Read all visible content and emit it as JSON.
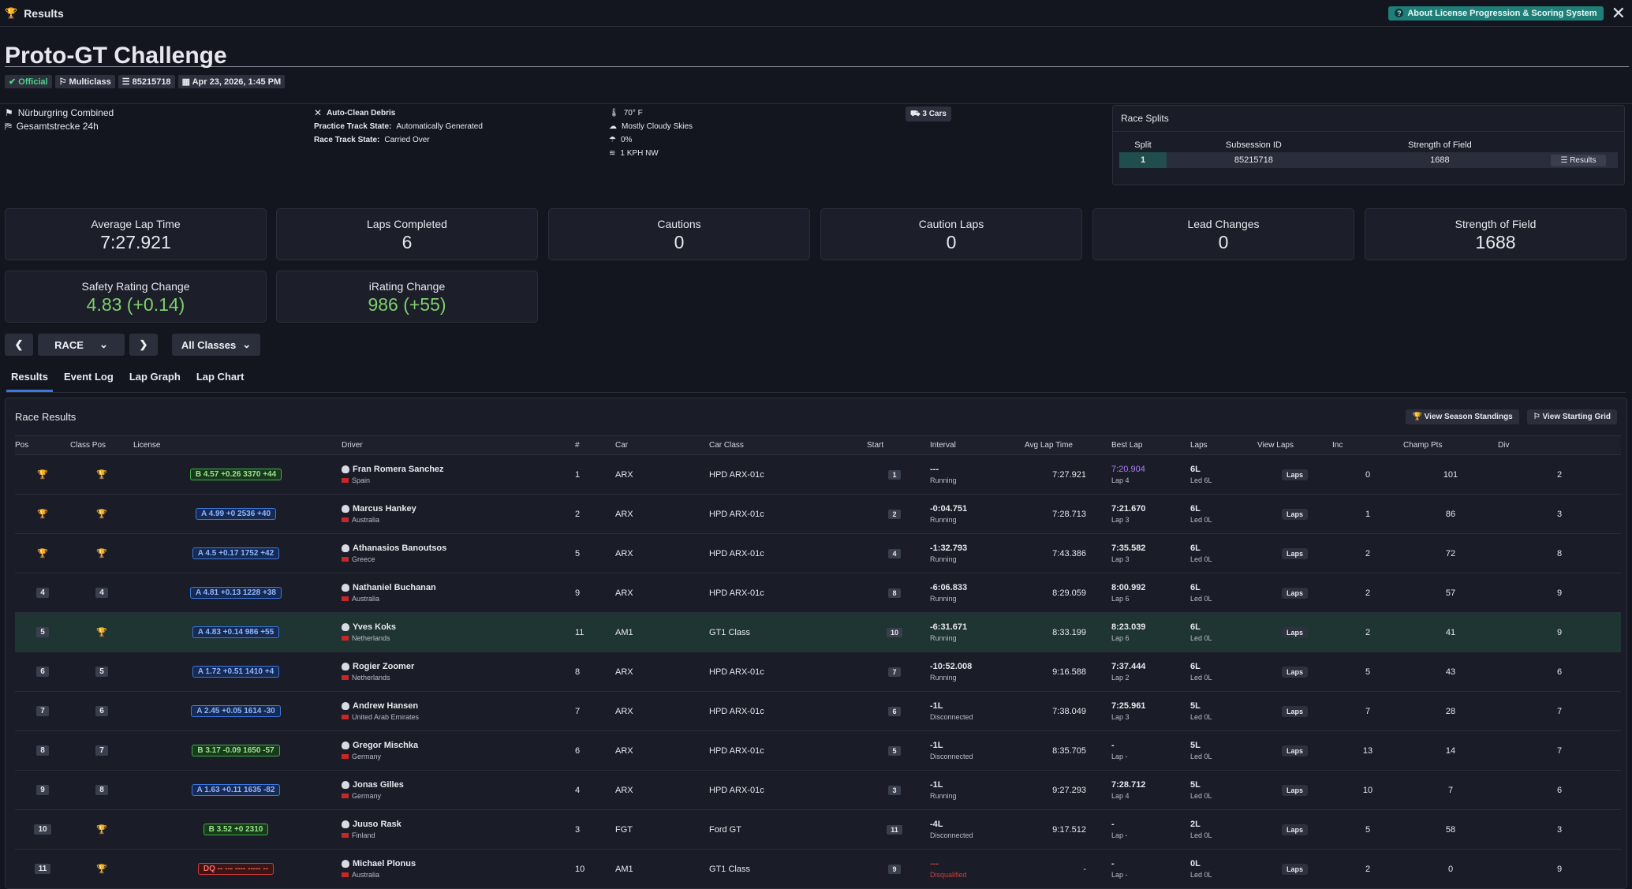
{
  "window": {
    "title": "Results",
    "about_label": "About License Progression & Scoring System"
  },
  "event": {
    "title": "Proto-GT Challenge",
    "badges": [
      "Official",
      "Multiclass",
      "85215718",
      "Apr 23, 2026, 1:45 PM"
    ]
  },
  "track": {
    "name": "Nürburgring Combined",
    "config": "Gesamtstrecke 24h"
  },
  "track_state": {
    "debris": "Auto-Clean Debris",
    "practice_label": "Practice Track State:",
    "practice_value": "Automatically Generated",
    "race_label": "Race Track State:",
    "race_value": "Carried Over"
  },
  "weather": {
    "temp": "70° F",
    "sky": "Mostly Cloudy Skies",
    "precip": "0%",
    "wind": "1 KPH NW"
  },
  "cars": "3 Cars",
  "race_splits": {
    "title": "Race Splits",
    "headers": [
      "Split",
      "Subsession ID",
      "Strength of Field",
      ""
    ],
    "row": {
      "split": "1",
      "subsession": "85215718",
      "sof": "1688",
      "button": "Results"
    }
  },
  "stats": [
    {
      "label": "Average Lap Time",
      "value": "7:27.921"
    },
    {
      "label": "Laps Completed",
      "value": "6"
    },
    {
      "label": "Cautions",
      "value": "0"
    },
    {
      "label": "Caution Laps",
      "value": "0"
    },
    {
      "label": "Lead Changes",
      "value": "0"
    },
    {
      "label": "Strength of Field",
      "value": "1688"
    },
    {
      "label": "Safety Rating Change",
      "value": "4.83 (+0.14)"
    },
    {
      "label": "iRating Change",
      "value": "986 (+55)"
    }
  ],
  "controls": {
    "session": "RACE",
    "class_filter": "All Classes"
  },
  "tabs": [
    "Results",
    "Event Log",
    "Lap Graph",
    "Lap Chart"
  ],
  "results": {
    "title": "Race Results",
    "btn_standings": "View Season Standings",
    "btn_grid": "View Starting Grid",
    "columns": [
      "Pos",
      "Class Pos",
      "License",
      "Driver",
      "#",
      "Car",
      "Car Class",
      "Start",
      "Interval",
      "Avg Lap Time",
      "Best Lap",
      "Laps",
      "View Laps",
      "Inc",
      "Champ Pts",
      "Div"
    ],
    "laps_button": "Laps",
    "rows": [
      {
        "pos": "1",
        "pos_trophy": "gold",
        "cpos": "1",
        "cpos_trophy": "gold",
        "lic_class": "B",
        "license": "B 4.57 +0.26 3370 +44",
        "driver": "Fran Romera Sanchez",
        "country": "Spain",
        "num": "1",
        "car": "ARX",
        "car_class": "HPD ARX-01c",
        "start": "1",
        "interval": "---",
        "status": "Running",
        "avg": "7:27.921",
        "best": "7:20.904",
        "best_lap": "Lap 4",
        "best_purple": true,
        "laps": "6L",
        "led": "Led 6L",
        "inc": "0",
        "pts": "101",
        "div": "2"
      },
      {
        "pos": "2",
        "pos_trophy": "silver",
        "cpos": "2",
        "cpos_trophy": "silver",
        "lic_class": "A",
        "license": "A 4.99 +0 2536 +40",
        "driver": "Marcus Hankey",
        "country": "Australia",
        "num": "2",
        "car": "ARX",
        "car_class": "HPD ARX-01c",
        "start": "2",
        "interval": "-0:04.751",
        "status": "Running",
        "avg": "7:28.713",
        "best": "7:21.670",
        "best_lap": "Lap 3",
        "laps": "6L",
        "led": "Led 0L",
        "inc": "1",
        "pts": "86",
        "div": "3"
      },
      {
        "pos": "3",
        "pos_trophy": "bronze",
        "cpos": "3",
        "cpos_trophy": "bronze",
        "lic_class": "A",
        "license": "A 4.5 +0.17 1752 +42",
        "driver": "Athanasios Banoutsos",
        "country": "Greece",
        "num": "5",
        "car": "ARX",
        "car_class": "HPD ARX-01c",
        "start": "4",
        "interval": "-1:32.793",
        "status": "Running",
        "avg": "7:43.386",
        "best": "7:35.582",
        "best_lap": "Lap 3",
        "laps": "6L",
        "led": "Led 0L",
        "inc": "2",
        "pts": "72",
        "div": "8"
      },
      {
        "pos": "4",
        "cpos": "4",
        "lic_class": "A",
        "license": "A 4.81 +0.13 1228 +38",
        "driver": "Nathaniel Buchanan",
        "country": "Australia",
        "num": "9",
        "car": "ARX",
        "car_class": "HPD ARX-01c",
        "start": "8",
        "interval": "-6:06.833",
        "status": "Running",
        "avg": "8:29.059",
        "best": "8:00.992",
        "best_lap": "Lap 6",
        "laps": "6L",
        "led": "Led 0L",
        "inc": "2",
        "pts": "57",
        "div": "9"
      },
      {
        "pos": "5",
        "cpos": "1",
        "cpos_trophy": "gold",
        "highlight": true,
        "lic_class": "A",
        "license": "A 4.83 +0.14 986 +55",
        "driver": "Yves Koks",
        "country": "Netherlands",
        "num": "11",
        "car": "AM1",
        "car_class": "GT1 Class",
        "start": "10",
        "interval": "-6:31.671",
        "status": "Running",
        "avg": "8:33.199",
        "best": "8:23.039",
        "best_lap": "Lap 6",
        "laps": "6L",
        "led": "Led 0L",
        "inc": "2",
        "pts": "41",
        "div": "9"
      },
      {
        "pos": "6",
        "cpos": "5",
        "lic_class": "A",
        "license": "A 1.72 +0.51 1410 +4",
        "driver": "Rogier Zoomer",
        "country": "Netherlands",
        "num": "8",
        "car": "ARX",
        "car_class": "HPD ARX-01c",
        "start": "7",
        "interval": "-10:52.008",
        "status": "Running",
        "avg": "9:16.588",
        "best": "7:37.444",
        "best_lap": "Lap 2",
        "laps": "6L",
        "led": "Led 0L",
        "inc": "5",
        "pts": "43",
        "div": "6"
      },
      {
        "pos": "7",
        "cpos": "6",
        "lic_class": "A",
        "license": "A 2.45 +0.05 1614 -30",
        "driver": "Andrew Hansen",
        "country": "United Arab Emirates",
        "num": "7",
        "car": "ARX",
        "car_class": "HPD ARX-01c",
        "start": "6",
        "interval": "-1L",
        "status": "Disconnected",
        "avg": "7:38.049",
        "best": "7:25.961",
        "best_lap": "Lap 3",
        "laps": "5L",
        "led": "Led 0L",
        "inc": "7",
        "pts": "28",
        "div": "7"
      },
      {
        "pos": "8",
        "cpos": "7",
        "lic_class": "B",
        "license": "B 3.17 -0.09 1650 -57",
        "driver": "Gregor Mischka",
        "country": "Germany",
        "num": "6",
        "car": "ARX",
        "car_class": "HPD ARX-01c",
        "start": "5",
        "interval": "-1L",
        "status": "Disconnected",
        "avg": "8:35.705",
        "best": "-",
        "best_lap": "Lap -",
        "laps": "5L",
        "led": "Led 0L",
        "inc": "13",
        "pts": "14",
        "div": "7"
      },
      {
        "pos": "9",
        "cpos": "8",
        "lic_class": "A",
        "license": "A 1.63 +0.11 1635 -82",
        "driver": "Jonas Gilles",
        "country": "Germany",
        "num": "4",
        "car": "ARX",
        "car_class": "HPD ARX-01c",
        "start": "3",
        "interval": "-1L",
        "status": "Running",
        "avg": "9:27.293",
        "best": "7:28.712",
        "best_lap": "Lap 4",
        "laps": "5L",
        "led": "Led 0L",
        "inc": "10",
        "pts": "7",
        "div": "6"
      },
      {
        "pos": "10",
        "cpos": "1",
        "cpos_trophy": "gold",
        "lic_class": "B",
        "license": "B 3.52 +0 2310",
        "driver": "Juuso Rask",
        "country": "Finland",
        "num": "3",
        "car": "FGT",
        "car_class": "Ford GT",
        "start": "11",
        "interval": "-4L",
        "status": "Disconnected",
        "avg": "9:17.512",
        "best": "-",
        "best_lap": "Lap -",
        "laps": "2L",
        "led": "Led 0L",
        "inc": "5",
        "pts": "58",
        "div": "3"
      },
      {
        "pos": "11",
        "cpos": "2",
        "cpos_trophy": "silver",
        "lic_class": "DQ",
        "license": "DQ -- --- ---- ----- --",
        "driver": "Michael Plonus",
        "country": "Australia",
        "num": "10",
        "car": "AM1",
        "car_class": "GT1 Class",
        "start": "9",
        "interval": "---",
        "status": "Disqualified",
        "dq": true,
        "avg": "-",
        "best": "-",
        "best_lap": "Lap -",
        "laps": "0L",
        "led": "Led 0L",
        "inc": "2",
        "pts": "0",
        "div": "9"
      }
    ]
  },
  "colors": {
    "accent": "#1f7f78",
    "tab_active": "#3a78d6",
    "license_a": "#3d78e0",
    "license_b": "#3fae45",
    "license_dq": "#d23b3b",
    "trophy_gold": "#e5c34a",
    "trophy_silver": "#d6d8de",
    "trophy_bronze": "#d9852a",
    "highlight_row": "#1e3533",
    "best_lap_purple": "#b07cff"
  }
}
